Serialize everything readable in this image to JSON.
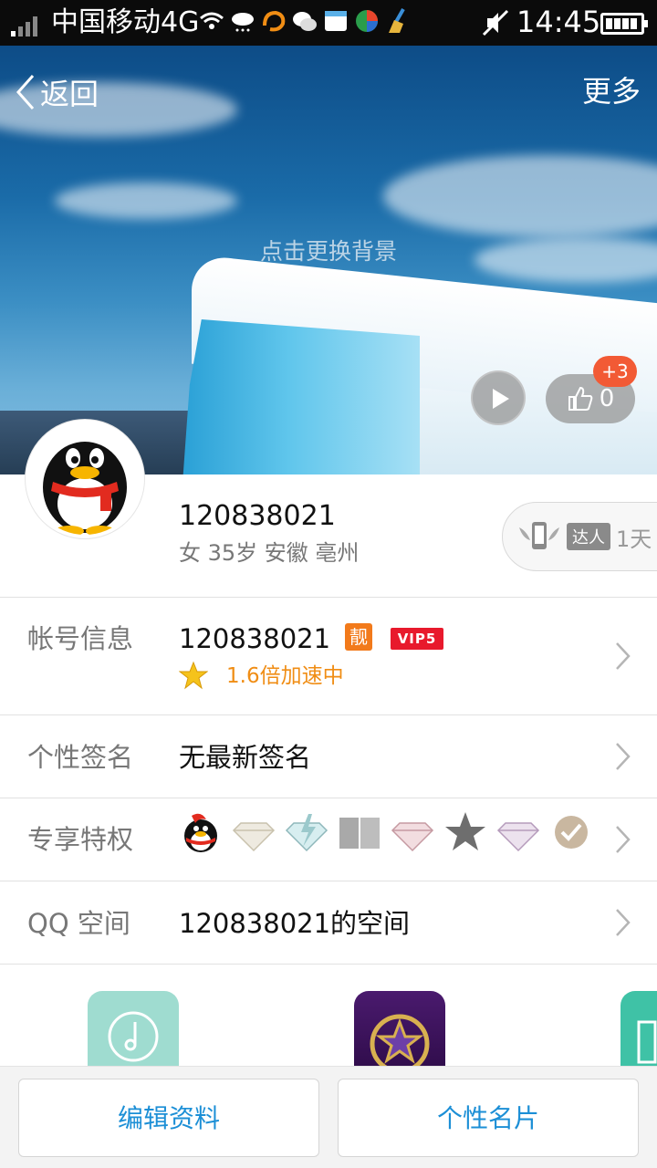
{
  "status_bar": {
    "carrier": "中国移动4G",
    "time": "14:45",
    "notification_icons": [
      "wifi-icon",
      "weather-icon",
      "uc-browser-icon",
      "wechat-icon",
      "store-icon",
      "app-icon",
      "cleaner-icon"
    ]
  },
  "topnav": {
    "back_label": "返回",
    "more_label": "更多"
  },
  "cover": {
    "hint": "点击更换背景",
    "like_count": "0",
    "like_badge": "+3"
  },
  "profile": {
    "username": "120838021",
    "info": "女 35岁 安徽 亳州",
    "expert_tag": "达人",
    "expert_days": "1天"
  },
  "rows": {
    "account": {
      "label": "帐号信息",
      "value": "120838021",
      "badge_liang": "靓",
      "badge_vip": "VIP5",
      "speed": "1.6倍加速中"
    },
    "signature": {
      "label": "个性签名",
      "value": "无最新签名"
    },
    "privileges": {
      "label": "专享特权",
      "icons": [
        "qq-penguin-icon",
        "diamond-icon",
        "diamond-lightning-icon",
        "book-icon",
        "pink-diamond-icon",
        "star-icon",
        "purple-diamond-icon",
        "check-coin-icon"
      ]
    },
    "qzone": {
      "label": "QQ 空间",
      "value": "120838021的空间"
    }
  },
  "bottom": {
    "edit_label": "编辑资料",
    "card_label": "个性名片"
  },
  "colors": {
    "accent_blue": "#1c8fd6",
    "speed_orange": "#f08d14",
    "vip_red": "#e8192c",
    "badge_red": "#f25a35"
  }
}
